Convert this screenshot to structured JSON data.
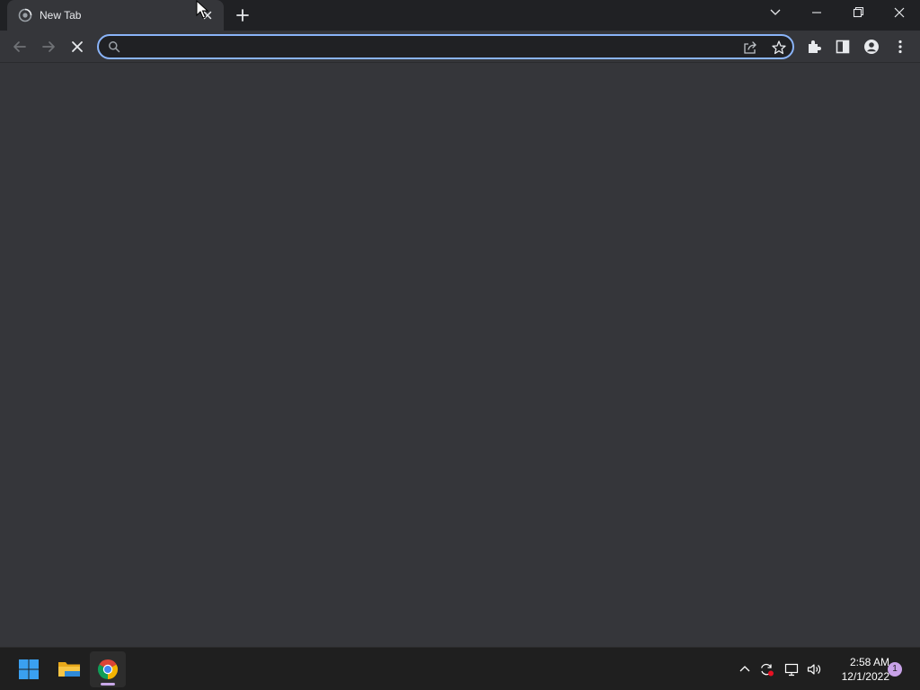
{
  "browser": {
    "tabs": [
      {
        "title": "New Tab",
        "favicon": "chrome-loading-icon",
        "active": true
      }
    ],
    "omnibox": {
      "value": "",
      "placeholder": ""
    },
    "colors": {
      "titlebar": "#202124",
      "toolbar": "#35363a",
      "omnibox_border": "#8ab4f8",
      "content": "#35363a"
    }
  },
  "taskbar": {
    "apps": [
      {
        "name": "start",
        "icon": "windows-start-icon"
      },
      {
        "name": "file-explorer",
        "icon": "folder-icon"
      },
      {
        "name": "chrome",
        "icon": "chrome-icon",
        "active": true
      }
    ],
    "tray": [
      "chevron-up-icon",
      "sync-icon",
      "network-icon",
      "volume-icon"
    ],
    "clock": {
      "time": "2:58 AM",
      "date": "12/1/2022"
    },
    "notifications": "1"
  }
}
